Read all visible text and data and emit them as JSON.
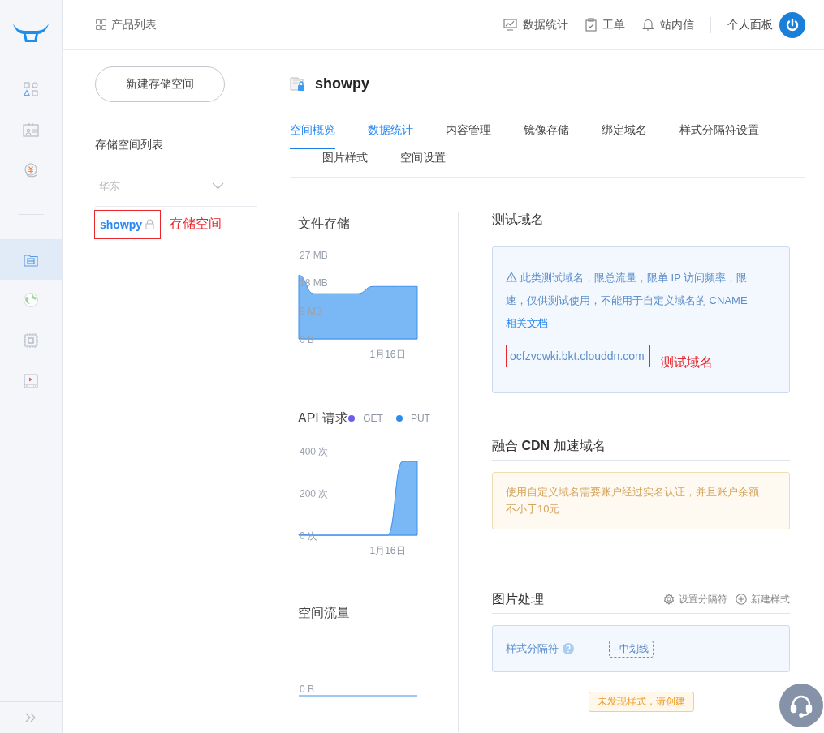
{
  "rail": {
    "items": [
      {
        "kind": "products",
        "selected": false
      },
      {
        "kind": "card",
        "selected": false
      },
      {
        "kind": "billing",
        "selected": false
      },
      {
        "kind": "storage",
        "selected": true
      },
      {
        "kind": "globe",
        "selected": false
      },
      {
        "kind": "chip",
        "selected": false
      },
      {
        "kind": "media",
        "selected": false
      }
    ]
  },
  "topbar": {
    "breadcrumb": "产品列表",
    "links": [
      {
        "kind": "stats",
        "label": "数据统计"
      },
      {
        "kind": "ticket",
        "label": "工单"
      },
      {
        "kind": "bell",
        "label": "站内信"
      }
    ],
    "account": "个人面板"
  },
  "side": {
    "new_button": "新建存储空间",
    "list_title": "存储空间列表",
    "region": {
      "label": "华东",
      "expanded": false
    },
    "buckets": [
      {
        "name": "showpy",
        "locked": true,
        "selected": true,
        "annotation": "存储空间"
      }
    ]
  },
  "main": {
    "title": "showpy",
    "tabs": [
      {
        "label": "空间概览",
        "selected": true,
        "hovered": false
      },
      {
        "label": "数据统计",
        "selected": false,
        "hovered": true
      },
      {
        "label": "内容管理",
        "selected": false,
        "hovered": false
      },
      {
        "label": "镜像存储",
        "selected": false,
        "hovered": false
      },
      {
        "label": "绑定域名",
        "selected": false,
        "hovered": false
      },
      {
        "label": "样式分隔符设置",
        "selected": false,
        "hovered": false
      },
      {
        "label": "图片样式",
        "selected": false,
        "hovered": false
      },
      {
        "label": "空间设置",
        "selected": false,
        "hovered": false
      }
    ],
    "file_storage": {
      "title": "文件存储",
      "chart_data": {
        "type": "area",
        "values": [
          20.4,
          14.5,
          14.5,
          14.5,
          14.5,
          16.8,
          16.8,
          16.8,
          16.8
        ],
        "ylim": [
          0,
          27
        ],
        "annotations": [
          "1月16日"
        ],
        "yticks": [
          {
            "value": 0,
            "label": "0 B"
          },
          {
            "value": 9,
            "label": "9 MB"
          },
          {
            "value": 18,
            "label": "18 MB"
          },
          {
            "value": 27,
            "label": "27 MB"
          }
        ]
      }
    },
    "api_requests": {
      "title": "API 请求",
      "legend": [
        {
          "name": "GET",
          "color": "#6b5cf2"
        },
        {
          "name": "PUT",
          "color": "#2b8cf0"
        }
      ],
      "chart_data": {
        "type": "area",
        "series": [
          {
            "color": "#7ab8f5",
            "values": [
              3,
              0,
              0,
              0,
              0,
              0,
              0,
              350,
              350
            ]
          }
        ],
        "ylim": [
          0,
          400
        ],
        "annotations": [
          "1月16日"
        ],
        "yticks": [
          {
            "value": 0,
            "label": "0 次"
          },
          {
            "value": 200,
            "label": "200 次"
          },
          {
            "value": 400,
            "label": "400 次"
          }
        ]
      }
    },
    "traffic": {
      "title": "空间流量",
      "tick": "0 B"
    },
    "test_domain": {
      "heading": "测试域名",
      "notice": "此类测试域名，限总流量，限单 IP 访问频率，限速，仅供测试使用，不能用于自定义域名的 CNAME",
      "link": "相关文档",
      "domain": "ocfzvcwki.bkt.clouddn.com",
      "annotation": "测试域名"
    },
    "cdn": {
      "heading": "融合 **CDN** 加速域名",
      "notice": "使用自定义域名需要账户经过实名认证，并且账户余额不小于10元"
    },
    "image": {
      "heading": "图片处理",
      "actions": [
        {
          "kind": "gear",
          "label": "设置分隔符"
        },
        {
          "kind": "plus",
          "label": "新建样式"
        }
      ],
      "separator_label": "样式分隔符",
      "separator_value": "- 中划线",
      "empty_badge": "未发现样式，请创建"
    }
  }
}
